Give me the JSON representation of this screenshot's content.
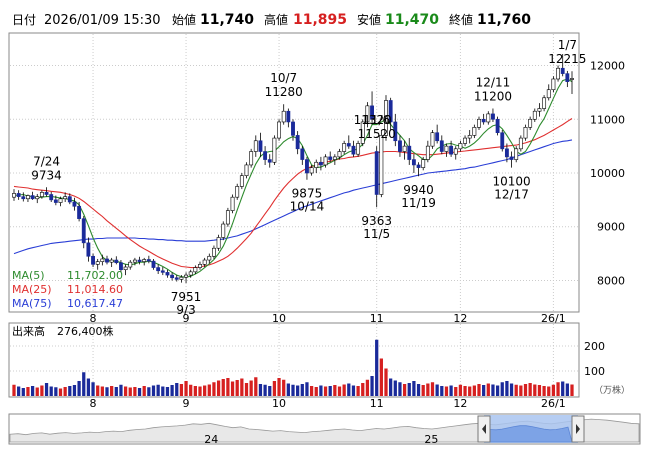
{
  "header": {
    "date_label": "日付",
    "datetime": "2026/01/09 15:30",
    "open_label": "始値",
    "open": "11,740",
    "high_label": "高値",
    "high": "11,895",
    "low_label": "安値",
    "low": "11,470",
    "close_label": "終値",
    "close": "11,760"
  },
  "ma_legend": [
    {
      "label": "MA(5)",
      "value": "11,702.00",
      "color": "#2e8b2e"
    },
    {
      "label": "MA(25)",
      "value": "11,014.60",
      "color": "#e03030"
    },
    {
      "label": "MA(75)",
      "value": "10,617.47",
      "color": "#2a3ed6"
    }
  ],
  "volume_legend": {
    "label": "出来高",
    "value": "276,400株"
  },
  "volume_unit": "（万株）",
  "colors": {
    "up": "#d62020",
    "down": "#1a2a9a",
    "frame": "#8a8a8a",
    "grid": "#cccccc"
  },
  "chart_data": {
    "type": "candlestick",
    "price_axis": {
      "ylim": [
        7450,
        12550
      ],
      "ticks": [
        8000,
        9000,
        10000,
        11000,
        12000
      ],
      "tick_labels": [
        "8000",
        "9000",
        "10000",
        "11000",
        "12000"
      ]
    },
    "volume_axis": {
      "ylim": [
        0,
        280
      ],
      "ticks": [
        100,
        200
      ],
      "tick_labels": [
        "100",
        "200"
      ]
    },
    "month_labels": [
      "8",
      "9",
      "10",
      "11",
      "12",
      "26/1"
    ],
    "month_start_index": [
      17,
      37,
      57,
      78,
      96,
      116
    ],
    "annotations": [
      {
        "index": 7,
        "date": "7/24",
        "value": "9734",
        "pos": "above"
      },
      {
        "index": 37,
        "date": "9/3",
        "value": "7951",
        "pos": "below"
      },
      {
        "index": 58,
        "date": "10/7",
        "value": "11280",
        "pos": "above"
      },
      {
        "index": 63,
        "date": "10/14",
        "value": "9875",
        "pos": "below"
      },
      {
        "index": 78,
        "date": "11/5",
        "value": "9363",
        "pos": "below"
      },
      {
        "index": 78,
        "date": "11/6",
        "value": "11520",
        "pos": "above",
        "extra": "11320"
      },
      {
        "index": 87,
        "date": "11/19",
        "value": "9940",
        "pos": "below"
      },
      {
        "index": 103,
        "date": "12/11",
        "value": "11200",
        "pos": "above"
      },
      {
        "index": 107,
        "date": "12/17",
        "value": "10100",
        "pos": "below"
      },
      {
        "index": 119,
        "date": "1/7",
        "value": "12215",
        "pos": "above"
      }
    ],
    "ohlc": [
      [
        9550,
        9700,
        9480,
        9620
      ],
      [
        9620,
        9680,
        9500,
        9560
      ],
      [
        9560,
        9640,
        9470,
        9520
      ],
      [
        9520,
        9600,
        9460,
        9580
      ],
      [
        9580,
        9650,
        9500,
        9520
      ],
      [
        9520,
        9610,
        9440,
        9560
      ],
      [
        9560,
        9680,
        9520,
        9640
      ],
      [
        9640,
        9734,
        9560,
        9600
      ],
      [
        9600,
        9650,
        9460,
        9500
      ],
      [
        9500,
        9580,
        9400,
        9450
      ],
      [
        9450,
        9560,
        9380,
        9520
      ],
      [
        9520,
        9640,
        9460,
        9560
      ],
      [
        9560,
        9620,
        9420,
        9460
      ],
      [
        9460,
        9540,
        9300,
        9380
      ],
      [
        9380,
        9460,
        9100,
        9150
      ],
      [
        9150,
        9200,
        8600,
        8700
      ],
      [
        8700,
        8800,
        8350,
        8450
      ],
      [
        8450,
        8500,
        8250,
        8300
      ],
      [
        8300,
        8400,
        8200,
        8350
      ],
      [
        8350,
        8480,
        8280,
        8400
      ],
      [
        8400,
        8460,
        8300,
        8340
      ],
      [
        8340,
        8420,
        8250,
        8380
      ],
      [
        8380,
        8450,
        8300,
        8330
      ],
      [
        8330,
        8380,
        8150,
        8200
      ],
      [
        8200,
        8300,
        8100,
        8250
      ],
      [
        8250,
        8380,
        8200,
        8340
      ],
      [
        8340,
        8420,
        8280,
        8380
      ],
      [
        8380,
        8440,
        8300,
        8350
      ],
      [
        8350,
        8420,
        8280,
        8390
      ],
      [
        8390,
        8460,
        8320,
        8360
      ],
      [
        8360,
        8400,
        8200,
        8240
      ],
      [
        8240,
        8300,
        8120,
        8180
      ],
      [
        8180,
        8250,
        8100,
        8150
      ],
      [
        8150,
        8200,
        8050,
        8100
      ],
      [
        8100,
        8150,
        8000,
        8050
      ],
      [
        8050,
        8100,
        7980,
        8020
      ],
      [
        8020,
        8100,
        7960,
        8060
      ],
      [
        8060,
        8150,
        7951,
        8100
      ],
      [
        8100,
        8200,
        8050,
        8160
      ],
      [
        8160,
        8280,
        8120,
        8240
      ],
      [
        8240,
        8350,
        8200,
        8300
      ],
      [
        8300,
        8420,
        8250,
        8380
      ],
      [
        8380,
        8500,
        8320,
        8450
      ],
      [
        8450,
        8650,
        8400,
        8600
      ],
      [
        8600,
        8850,
        8550,
        8800
      ],
      [
        8800,
        9100,
        8750,
        9050
      ],
      [
        9050,
        9350,
        9000,
        9300
      ],
      [
        9300,
        9600,
        9250,
        9550
      ],
      [
        9550,
        9800,
        9500,
        9750
      ],
      [
        9750,
        10000,
        9700,
        9950
      ],
      [
        9950,
        10200,
        9900,
        10150
      ],
      [
        10150,
        10450,
        10100,
        10400
      ],
      [
        10400,
        10700,
        10300,
        10600
      ],
      [
        10600,
        10750,
        10300,
        10400
      ],
      [
        10400,
        10500,
        10150,
        10250
      ],
      [
        10250,
        10350,
        10100,
        10200
      ],
      [
        10200,
        10700,
        10150,
        10650
      ],
      [
        10650,
        11000,
        10600,
        10950
      ],
      [
        10950,
        11280,
        10900,
        11150
      ],
      [
        11150,
        11200,
        10850,
        10950
      ],
      [
        10950,
        11000,
        10600,
        10700
      ],
      [
        10700,
        10780,
        10350,
        10450
      ],
      [
        10450,
        10500,
        10150,
        10250
      ],
      [
        10250,
        10300,
        9875,
        10000
      ],
      [
        10000,
        10150,
        9950,
        10100
      ],
      [
        10100,
        10250,
        10000,
        10200
      ],
      [
        10200,
        10300,
        10050,
        10150
      ],
      [
        10150,
        10350,
        10100,
        10300
      ],
      [
        10300,
        10400,
        10200,
        10250
      ],
      [
        10250,
        10350,
        10150,
        10300
      ],
      [
        10300,
        10450,
        10250,
        10400
      ],
      [
        10400,
        10600,
        10350,
        10550
      ],
      [
        10550,
        10700,
        10450,
        10500
      ],
      [
        10500,
        10600,
        10300,
        10350
      ],
      [
        10350,
        10600,
        10300,
        10550
      ],
      [
        10550,
        11000,
        10500,
        10950
      ],
      [
        10950,
        11320,
        10850,
        11250
      ],
      [
        11250,
        11520,
        10900,
        11000
      ],
      [
        10400,
        10500,
        9363,
        9600
      ],
      [
        9600,
        10800,
        9550,
        10700
      ],
      [
        10700,
        11450,
        10600,
        11350
      ],
      [
        11350,
        11400,
        10800,
        10950
      ],
      [
        10950,
        11100,
        10500,
        10600
      ],
      [
        10600,
        10700,
        10300,
        10400
      ],
      [
        10400,
        10600,
        10250,
        10500
      ],
      [
        10500,
        10650,
        10150,
        10250
      ],
      [
        10250,
        10350,
        10000,
        10150
      ],
      [
        10150,
        10200,
        9940,
        10100
      ],
      [
        10100,
        10300,
        10050,
        10250
      ],
      [
        10250,
        10600,
        10200,
        10500
      ],
      [
        10500,
        10800,
        10450,
        10750
      ],
      [
        10750,
        10900,
        10550,
        10600
      ],
      [
        10600,
        10700,
        10350,
        10400
      ],
      [
        10400,
        10550,
        10300,
        10500
      ],
      [
        10500,
        10600,
        10300,
        10350
      ],
      [
        10350,
        10500,
        10250,
        10450
      ],
      [
        10450,
        10600,
        10400,
        10550
      ],
      [
        10550,
        10700,
        10500,
        10650
      ],
      [
        10650,
        10800,
        10550,
        10700
      ],
      [
        10700,
        10900,
        10650,
        10850
      ],
      [
        10850,
        11050,
        10800,
        11000
      ],
      [
        11000,
        11100,
        10900,
        10950
      ],
      [
        10950,
        11150,
        10900,
        11100
      ],
      [
        11100,
        11200,
        10950,
        11000
      ],
      [
        11000,
        11050,
        10700,
        10750
      ],
      [
        10750,
        10800,
        10400,
        10450
      ],
      [
        10450,
        10550,
        10200,
        10300
      ],
      [
        10300,
        10400,
        10100,
        10250
      ],
      [
        10250,
        10500,
        10200,
        10450
      ],
      [
        10450,
        10700,
        10400,
        10650
      ],
      [
        10650,
        10900,
        10600,
        10850
      ],
      [
        10850,
        11050,
        10800,
        11000
      ],
      [
        11000,
        11200,
        10950,
        11150
      ],
      [
        11150,
        11300,
        11050,
        11200
      ],
      [
        11200,
        11450,
        11150,
        11400
      ],
      [
        11400,
        11650,
        11350,
        11550
      ],
      [
        11550,
        11800,
        11500,
        11750
      ],
      [
        11750,
        12000,
        11700,
        11950
      ],
      [
        11950,
        12215,
        11800,
        11850
      ],
      [
        11850,
        11900,
        11600,
        11700
      ],
      [
        11740,
        11895,
        11470,
        11760
      ]
    ],
    "volume": [
      45,
      38,
      32,
      36,
      40,
      34,
      42,
      52,
      38,
      35,
      30,
      36,
      40,
      44,
      60,
      95,
      70,
      55,
      42,
      38,
      35,
      40,
      36,
      45,
      38,
      34,
      36,
      32,
      40,
      35,
      42,
      45,
      38,
      36,
      44,
      52,
      48,
      60,
      45,
      40,
      38,
      42,
      46,
      55,
      62,
      68,
      72,
      58,
      64,
      70,
      52,
      62,
      75,
      48,
      45,
      40,
      60,
      72,
      65,
      50,
      45,
      42,
      48,
      55,
      40,
      36,
      42,
      38,
      40,
      44,
      38,
      46,
      50,
      42,
      40,
      52,
      65,
      80,
      225,
      150,
      110,
      70,
      62,
      55,
      48,
      52,
      60,
      48,
      44,
      50,
      55,
      46,
      40,
      38,
      42,
      36,
      45,
      40,
      38,
      42,
      48,
      44,
      50,
      46,
      42,
      55,
      60,
      50,
      45,
      42,
      48,
      52,
      46,
      44,
      40,
      38,
      45,
      55,
      58,
      50,
      46
    ],
    "ma5": [
      9580,
      9590,
      9600,
      9570,
      9560,
      9540,
      9550,
      9560,
      9565,
      9550,
      9535,
      9530,
      9500,
      9480,
      9410,
      9230,
      9020,
      8790,
      8600,
      8440,
      8370,
      8360,
      8360,
      8330,
      8300,
      8290,
      8310,
      8340,
      8340,
      8360,
      8340,
      8300,
      8260,
      8210,
      8150,
      8100,
      8070,
      8060,
      8080,
      8120,
      8170,
      8240,
      8310,
      8390,
      8500,
      8640,
      8830,
      9060,
      9310,
      9550,
      9780,
      9980,
      10170,
      10310,
      10380,
      10400,
      10410,
      10490,
      10580,
      10640,
      10680,
      10640,
      10510,
      10320,
      10150,
      10100,
      10110,
      10150,
      10190,
      10240,
      10280,
      10340,
      10390,
      10420,
      10450,
      10540,
      10700,
      10900,
      10900,
      10950,
      11000,
      10900,
      10800,
      10700,
      10600,
      10450,
      10380,
      10320,
      10250,
      10250,
      10330,
      10450,
      10500,
      10540,
      10550,
      10520,
      10500,
      10460,
      10500,
      10560,
      10640,
      10740,
      10820,
      10880,
      10900,
      10820,
      10700,
      10560,
      10400,
      10350,
      10400,
      10540,
      10700,
      10880,
      11010,
      11200,
      11390,
      11580,
      11720,
      11750,
      11702
    ],
    "ma25": [
      9750,
      9740,
      9730,
      9720,
      9700,
      9690,
      9680,
      9670,
      9660,
      9650,
      9640,
      9620,
      9600,
      9570,
      9530,
      9470,
      9400,
      9330,
      9260,
      9190,
      9110,
      9040,
      8970,
      8900,
      8830,
      8760,
      8700,
      8640,
      8590,
      8540,
      8490,
      8440,
      8400,
      8360,
      8320,
      8290,
      8260,
      8250,
      8240,
      8240,
      8250,
      8270,
      8290,
      8320,
      8360,
      8400,
      8450,
      8520,
      8600,
      8690,
      8780,
      8880,
      9000,
      9120,
      9240,
      9360,
      9490,
      9610,
      9720,
      9820,
      9900,
      9980,
      10040,
      10090,
      10120,
      10150,
      10180,
      10200,
      10220,
      10240,
      10260,
      10270,
      10290,
      10300,
      10310,
      10330,
      10350,
      10370,
      10380,
      10390,
      10400,
      10400,
      10400,
      10390,
      10380,
      10370,
      10360,
      10350,
      10340,
      10340,
      10340,
      10350,
      10360,
      10370,
      10380,
      10390,
      10400,
      10410,
      10420,
      10430,
      10440,
      10450,
      10460,
      10470,
      10480,
      10490,
      10500,
      10510,
      10520,
      10540,
      10560,
      10590,
      10620,
      10660,
      10700,
      10750,
      10800,
      10850,
      10900,
      10960,
      11014
    ],
    "ma75": [
      8500,
      8530,
      8560,
      8590,
      8610,
      8630,
      8650,
      8670,
      8690,
      8700,
      8710,
      8720,
      8730,
      8740,
      8750,
      8760,
      8770,
      8770,
      8780,
      8780,
      8790,
      8790,
      8790,
      8790,
      8790,
      8790,
      8790,
      8780,
      8780,
      8770,
      8770,
      8760,
      8760,
      8750,
      8750,
      8740,
      8740,
      8730,
      8730,
      8730,
      8730,
      8730,
      8740,
      8750,
      8760,
      8770,
      8790,
      8810,
      8830,
      8860,
      8890,
      8920,
      8960,
      9000,
      9040,
      9080,
      9120,
      9160,
      9200,
      9240,
      9280,
      9320,
      9360,
      9390,
      9420,
      9450,
      9480,
      9510,
      9540,
      9570,
      9600,
      9630,
      9650,
      9680,
      9700,
      9720,
      9740,
      9760,
      9780,
      9800,
      9820,
      9840,
      9860,
      9880,
      9900,
      9920,
      9940,
      9960,
      9980,
      10000,
      10010,
      10020,
      10030,
      10040,
      10050,
      10060,
      10070,
      10080,
      10100,
      10110,
      10130,
      10150,
      10170,
      10190,
      10210,
      10230,
      10250,
      10280,
      10310,
      10340,
      10370,
      10400,
      10430,
      10460,
      10490,
      10520,
      10550,
      10570,
      10590,
      10600,
      10617
    ],
    "navigator_labels": [
      {
        "text": "24",
        "pos": 0.32
      },
      {
        "text": "25",
        "pos": 0.67
      }
    ],
    "navigator_history": [
      0.3,
      0.32,
      0.28,
      0.33,
      0.35,
      0.3,
      0.34,
      0.36,
      0.33,
      0.35,
      0.38,
      0.36,
      0.4,
      0.42,
      0.4,
      0.45,
      0.48,
      0.5,
      0.55,
      0.58,
      0.6,
      0.62,
      0.65,
      0.7,
      0.68,
      0.72,
      0.66,
      0.6,
      0.55,
      0.58,
      0.5,
      0.48,
      0.45,
      0.42,
      0.44,
      0.4,
      0.38,
      0.36,
      0.4,
      0.42,
      0.45,
      0.48,
      0.5,
      0.46,
      0.44,
      0.48,
      0.52,
      0.5,
      0.54,
      0.58,
      0.6,
      0.55,
      0.52,
      0.5,
      0.54,
      0.58,
      0.62,
      0.66,
      0.7,
      0.72,
      0.68,
      0.66,
      0.7,
      0.74,
      0.78,
      0.8,
      0.76,
      0.72,
      0.7,
      0.74,
      0.78,
      0.82,
      0.85,
      0.88,
      0.86,
      0.84,
      0.8,
      0.76,
      0.72,
      0.7
    ]
  }
}
